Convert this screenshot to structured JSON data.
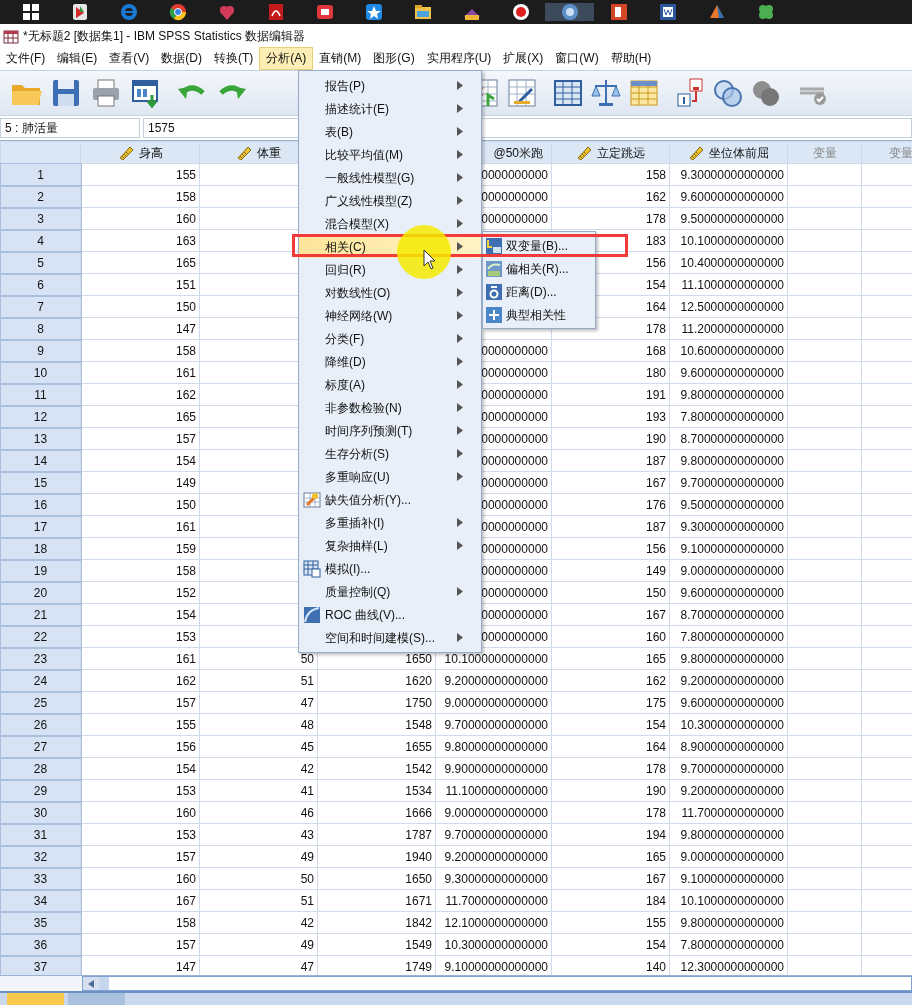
{
  "window": {
    "title": "*无标题2 [数据集1] - IBM SPSS Statistics 数据编辑器"
  },
  "menubar": [
    {
      "label": "文件(F)",
      "selected": false
    },
    {
      "label": "编辑(E)",
      "selected": false
    },
    {
      "label": "查看(V)",
      "selected": false
    },
    {
      "label": "数据(D)",
      "selected": false
    },
    {
      "label": "转换(T)",
      "selected": false
    },
    {
      "label": "分析(A)",
      "selected": true
    },
    {
      "label": "直销(M)",
      "selected": false
    },
    {
      "label": "图形(G)",
      "selected": false
    },
    {
      "label": "实用程序(U)",
      "selected": false
    },
    {
      "label": "扩展(X)",
      "selected": false
    },
    {
      "label": "窗口(W)",
      "selected": false
    },
    {
      "label": "帮助(H)",
      "selected": false
    }
  ],
  "cell_bar": {
    "reference": "5 : 肺活量",
    "value": "1575"
  },
  "grid": {
    "columns": [
      {
        "label": "身高",
        "kind": "scale"
      },
      {
        "label": "体重",
        "kind": "scale"
      },
      {
        "kind": "hidden"
      },
      {
        "label": "@50米跑",
        "kind": "cut"
      },
      {
        "label": "立定跳远",
        "kind": "scale"
      },
      {
        "label": "坐位体前屈",
        "kind": "scale"
      },
      {
        "label": "变量",
        "kind": "empty"
      },
      {
        "label": "变量",
        "kind": "empty"
      }
    ],
    "rows": [
      {
        "number": "1",
        "cells": [
          "155",
          null,
          null,
          "0000000000",
          "158",
          "9.30000000000000"
        ]
      },
      {
        "number": "2",
        "cells": [
          "158",
          null,
          null,
          "0000000000",
          "162",
          "9.60000000000000"
        ]
      },
      {
        "number": "3",
        "cells": [
          "160",
          null,
          null,
          "0000000000",
          "178",
          "9.50000000000000"
        ]
      },
      {
        "number": "4",
        "cells": [
          "163",
          null,
          null,
          null,
          "183",
          "10.1000000000000"
        ]
      },
      {
        "number": "5",
        "cells": [
          "165",
          null,
          null,
          null,
          "156",
          "10.4000000000000"
        ]
      },
      {
        "number": "6",
        "cells": [
          "151",
          null,
          null,
          null,
          "154",
          "11.1000000000000"
        ]
      },
      {
        "number": "7",
        "cells": [
          "150",
          null,
          null,
          null,
          "164",
          "12.5000000000000"
        ]
      },
      {
        "number": "8",
        "cells": [
          "147",
          null,
          null,
          null,
          "178",
          "11.2000000000000"
        ]
      },
      {
        "number": "9",
        "cells": [
          "158",
          null,
          null,
          "0000000000",
          "168",
          "10.6000000000000"
        ]
      },
      {
        "number": "10",
        "cells": [
          "161",
          null,
          null,
          "0000000000",
          "180",
          "9.60000000000000"
        ]
      },
      {
        "number": "11",
        "cells": [
          "162",
          null,
          null,
          "0000000000",
          "191",
          "9.80000000000000"
        ]
      },
      {
        "number": "12",
        "cells": [
          "165",
          null,
          null,
          "0000000000",
          "193",
          "7.80000000000000"
        ]
      },
      {
        "number": "13",
        "cells": [
          "157",
          null,
          null,
          "0000000000",
          "190",
          "8.70000000000000"
        ]
      },
      {
        "number": "14",
        "cells": [
          "154",
          null,
          null,
          "0000000000",
          "187",
          "9.80000000000000"
        ]
      },
      {
        "number": "15",
        "cells": [
          "149",
          null,
          null,
          "0000000000",
          "167",
          "9.70000000000000"
        ]
      },
      {
        "number": "16",
        "cells": [
          "150",
          null,
          null,
          "0000000000",
          "176",
          "9.50000000000000"
        ]
      },
      {
        "number": "17",
        "cells": [
          "161",
          null,
          null,
          "0000000000",
          "187",
          "9.30000000000000"
        ]
      },
      {
        "number": "18",
        "cells": [
          "159",
          null,
          null,
          "0000000000",
          "156",
          "9.10000000000000"
        ]
      },
      {
        "number": "19",
        "cells": [
          "158",
          null,
          null,
          "0000000000",
          "149",
          "9.00000000000000"
        ]
      },
      {
        "number": "20",
        "cells": [
          "152",
          null,
          null,
          "0000000000",
          "150",
          "9.60000000000000"
        ]
      },
      {
        "number": "21",
        "cells": [
          "154",
          null,
          null,
          "0000000000",
          "167",
          "8.70000000000000"
        ]
      },
      {
        "number": "22",
        "cells": [
          "153",
          null,
          null,
          "0000000000",
          "160",
          "7.80000000000000"
        ]
      },
      {
        "number": "23",
        "cells": [
          "161",
          "50",
          "1650",
          "10.1000000000000",
          "165",
          "9.80000000000000"
        ]
      },
      {
        "number": "24",
        "cells": [
          "162",
          "51",
          "1620",
          "9.20000000000000",
          "162",
          "9.20000000000000"
        ]
      },
      {
        "number": "25",
        "cells": [
          "157",
          "47",
          "1750",
          "9.00000000000000",
          "175",
          "9.60000000000000"
        ]
      },
      {
        "number": "26",
        "cells": [
          "155",
          "48",
          "1548",
          "9.70000000000000",
          "154",
          "10.3000000000000"
        ]
      },
      {
        "number": "27",
        "cells": [
          "156",
          "45",
          "1655",
          "9.80000000000000",
          "164",
          "8.90000000000000"
        ]
      },
      {
        "number": "28",
        "cells": [
          "154",
          "42",
          "1542",
          "9.90000000000000",
          "178",
          "9.70000000000000"
        ]
      },
      {
        "number": "29",
        "cells": [
          "153",
          "41",
          "1534",
          "11.1000000000000",
          "190",
          "9.20000000000000"
        ]
      },
      {
        "number": "30",
        "cells": [
          "160",
          "46",
          "1666",
          "9.00000000000000",
          "178",
          "11.7000000000000"
        ]
      },
      {
        "number": "31",
        "cells": [
          "153",
          "43",
          "1787",
          "9.70000000000000",
          "194",
          "9.80000000000000"
        ]
      },
      {
        "number": "32",
        "cells": [
          "157",
          "49",
          "1940",
          "9.20000000000000",
          "165",
          "9.00000000000000"
        ]
      },
      {
        "number": "33",
        "cells": [
          "160",
          "50",
          "1650",
          "9.30000000000000",
          "167",
          "9.10000000000000"
        ]
      },
      {
        "number": "34",
        "cells": [
          "167",
          "51",
          "1671",
          "11.7000000000000",
          "184",
          "10.1000000000000"
        ]
      },
      {
        "number": "35",
        "cells": [
          "158",
          "42",
          "1842",
          "12.1000000000000",
          "155",
          "9.80000000000000"
        ]
      },
      {
        "number": "36",
        "cells": [
          "157",
          "49",
          "1549",
          "10.3000000000000",
          "154",
          "7.80000000000000"
        ]
      },
      {
        "number": "37",
        "cells": [
          "147",
          "47",
          "1749",
          "9.10000000000000",
          "140",
          "12.3000000000000"
        ]
      }
    ]
  },
  "analyze_menu": {
    "items": [
      {
        "label": "报告(P)",
        "kind": "submenu",
        "selected": false
      },
      {
        "label": "描述统计(E)",
        "kind": "submenu",
        "selected": false
      },
      {
        "label": "表(B)",
        "kind": "submenu",
        "selected": false
      },
      {
        "label": "比较平均值(M)",
        "kind": "submenu",
        "selected": false
      },
      {
        "label": "一般线性模型(G)",
        "kind": "submenu",
        "selected": false
      },
      {
        "label": "广义线性模型(Z)",
        "kind": "submenu",
        "selected": false
      },
      {
        "label": "混合模型(X)",
        "kind": "submenu",
        "selected": false
      },
      {
        "label": "相关(C)",
        "kind": "submenu",
        "selected": true
      },
      {
        "label": "回归(R)",
        "kind": "submenu",
        "selected": false
      },
      {
        "label": "对数线性(O)",
        "kind": "submenu",
        "selected": false
      },
      {
        "label": "神经网络(W)",
        "kind": "submenu",
        "selected": false
      },
      {
        "label": "分类(F)",
        "kind": "submenu",
        "selected": false
      },
      {
        "label": "降维(D)",
        "kind": "submenu",
        "selected": false
      },
      {
        "label": "标度(A)",
        "kind": "submenu",
        "selected": false
      },
      {
        "label": "非参数检验(N)",
        "kind": "submenu",
        "selected": false
      },
      {
        "label": "时间序列预测(T)",
        "kind": "submenu",
        "selected": false
      },
      {
        "label": "生存分析(S)",
        "kind": "submenu",
        "selected": false
      },
      {
        "label": "多重响应(U)",
        "kind": "submenu",
        "selected": false
      },
      {
        "label": "缺失值分析(Y)...",
        "kind": "command",
        "selected": false
      },
      {
        "label": "多重插补(I)",
        "kind": "submenu",
        "selected": false
      },
      {
        "label": "复杂抽样(L)",
        "kind": "submenu",
        "selected": false
      },
      {
        "label": "模拟(I)...",
        "kind": "command",
        "selected": false
      },
      {
        "label": "质量控制(Q)",
        "kind": "submenu",
        "selected": false
      },
      {
        "label": "ROC 曲线(V)...",
        "kind": "command",
        "selected": false
      },
      {
        "label": "空间和时间建模(S)...",
        "kind": "submenu",
        "selected": false
      }
    ]
  },
  "correlate_submenu": {
    "items": [
      {
        "label": "双变量(B)..."
      },
      {
        "label": "偏相关(R)..."
      },
      {
        "label": "距离(D)..."
      },
      {
        "label": "典型相关性"
      }
    ]
  },
  "bottom_tabs": [
    {
      "selected": true
    },
    {
      "selected": false
    }
  ]
}
